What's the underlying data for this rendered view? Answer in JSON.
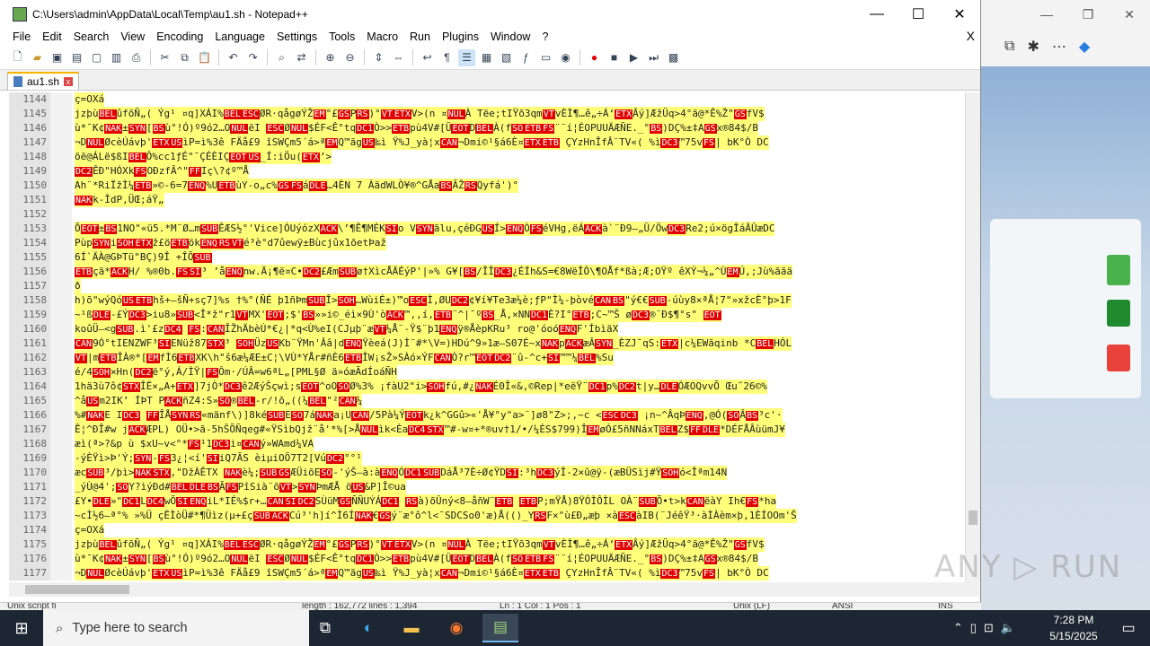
{
  "window": {
    "title": "C:\\Users\\admin\\AppData\\Local\\Temp\\au1.sh - Notepad++",
    "minimize": "—",
    "maximize": "☐",
    "close": "✕"
  },
  "menu": {
    "items": [
      "File",
      "Edit",
      "Search",
      "View",
      "Encoding",
      "Language",
      "Settings",
      "Tools",
      "Macro",
      "Run",
      "Plugins",
      "Window",
      "?"
    ],
    "close": "X"
  },
  "tab": {
    "label": "au1.sh",
    "close": "x"
  },
  "editor": {
    "lines": [
      {
        "n": "1144",
        "hl": true,
        "t": "ç=OXá"
      },
      {
        "n": "1145",
        "hl": true,
        "t": "    jzþùBELûfõÑ„( Ýg¹ ¤q]XÁI%BELESCØR·qågøÝŽEM°£GSPRS)°VTETXV>(n ¤NULÀ Tëe;tIŸõ3qmVTvÈÌ¶…ê„÷Á‘ETXÂý]ÆžÜq>4°ä@*Ê%Ž\"GSfV$"
      },
      {
        "n": "1146",
        "hl": true,
        "t": "ù*¯K¢NAK±SYN[BSù°!Ó)º9ó2…ONULëI ESCØNUL$ÉF<Ê°tqDC1Ò>>ETBpù4V#[ÜEOTDBELÀ(fSOETBFS¨¨í¦ÉOPUUÄÆÑE._°BS)DÇ%±‡AGSx®84$/B"
      },
      {
        "n": "1147",
        "hl": true,
        "t": "¬DNULØcèÚávþ'ETXUSìP=ì%3ê  FÄå£9 îSWÇm5´á>ªEMQ™ãgUS‰ì Ÿ%J_yà¦xCAN¬Dmi©¹§á6È¤ETXETB   ÇYzHnÎfÂ¨TV«( %ìDC3™75vFS| bK°Ò DC"
      },
      {
        "n": "1148",
        "hl": true,
        "t": "öë@ÁLë$ßIBELÔ%cc1ƒÉ\"¯ÇÉÈIÇEOTUS_Í:iÖu(ETX’>"
      },
      {
        "n": "1149",
        "hl": true,
        "t": "DC2ÊÐ\"HÓXkFSOÐzfÂ^\"FFIç\\?¢º™Å"
      },
      {
        "n": "1150",
        "hl": true,
        "t": "Ah¨*RiÏžÌ¼ETB»©-6=7ENQ%UETBùY-o„c%GSFSáDLE…4ÈN 7 ÀädWLÒ¥®^GÅaBSÃŽRSQyfá')°"
      },
      {
        "n": "1151",
        "hl": true,
        "t": "NAKk-ÎdP,ÜŒ;áŸ„"
      },
      {
        "n": "1152",
        "hl": false,
        "t": ""
      },
      {
        "n": "1153",
        "hl": true,
        "t": "ÕEOT±BS1NO\"«ü5.*M¨Ø…mSUBÊÆS½°'Vice]ÓUýózXACK\\’¶Ê¶MÉKSIo   VSYNãlu,çéÐGUSÍ>ENQÒFSéVHg,ëÁACKà`¨Ð9–„Ü/ÖwDC3Re2;ú×ögÎáÂÛæDC"
      },
      {
        "n": "1154",
        "hl": true,
        "t": "PùpSYNiSOHETXž£öETBökENQRSVTé³è°d7ûewÿ±Bùcjûx1õetÞaž"
      },
      {
        "n": "1155",
        "hl": true,
        "t": "6Í`ÄÀ@GÞTü\"BÇ)9Î +ÎÕSUB"
      },
      {
        "n": "1156",
        "hl": true,
        "t": "ETBçã*ACKH/ %®0b.FSSI³ ’åENQnw.Ä¡¶ë¤C•DC2£ÆmSUBø†XìcÅÄÉýP'|»% G¥[BS/ÎÎDC3¿ÉÍh&S=€8WëÎÔ\\¶OÅf*ßà;Æ;OŸº êXÝ¬¼„^ÙEMÚ,;Jù%ããä"
      },
      {
        "n": "1157",
        "hl": true,
        "t": "ð"
      },
      {
        "n": "1158",
        "hl": true,
        "t": "h)õ\"wýQóUSETBhš+—šÑ+sç7]%s †%°(ÑÉ þ1ñÞmSUBÎ>SOH…WùiÉ±)™oESCÌ,ØUDC2¢¥í¥Te3æ¼è;ƒP\"Ì¼-þòvéCANBS\"ý€€SUB-úùy8×ªÅ¦7\"»xžcÈ°þ>1F"
      },
      {
        "n": "1159",
        "hl": true,
        "t": "~¹ßDLE-£ÝDC3>iu8»SUB<Î*ž\"r1VTMX'EOT;$'BS»»i©_éì×9Ù'òACK™,,í,ETB¨^|¯ºBS_Å,×NNDC1È?I°ETB;C~™Š    øDC3®¨Ð$¶°s\"   EOT"
      },
      {
        "n": "1160",
        "hl": true,
        "t": "koûÜ–<gSUB.ì'£zDC4 FS:CANÎŽhÄbèÚ*€¿|*q<Ù%eI(CJµþ¨æVT¼Å¨-Ÿ$¨þ1ENQÿ®ÅèpKRu³ ro@'óoóENQF'ÍbìäX"
      },
      {
        "n": "1161",
        "hl": true,
        "t": "CAN9Ó°tIENZWF³SIENüž87STX³ SOHÜzUSKb¨ŸMn'Ââ|dENQŸèeá(J)Ì¨#*\\V=)HDú^9»1æ—S07É~xNAKpACKæÂSYN_ÈZJ¯qS:ETX|c¼EWãqinb *CBELHÓL"
      },
      {
        "n": "1162",
        "hl": true,
        "t": "VT|mETBÎÀ®*[EMfÌ6ETBXK\\h\"š6æ¼ÆE±C¦\\VÙ*YÅr#ñÈ6ETBÎW¡sŽ»SÀó×ÝFCANÒ?r™EOTDC2¨û-^c+SI™™¼BEL%Su"
      },
      {
        "n": "1163",
        "hl": true,
        "t": "é/4SOH×Hn(DC2ë°ý,Á/ÌŸ|FSÔm·/ÚÂ=w6ªL„[PML§Ø     ä»óæÃdÍoáÑH"
      },
      {
        "n": "1164",
        "hl": true,
        "t": "1hä3ù7ô¢STXÎË×„A+ETX]7jÒ*DC3ê2ÆýŠçwì;sEOT^oOSOØ%3%     ¡fàU2\"i>SOHfú,#¿NAKÉ0Î«&,©Rep|*eëŸ¨DC1p%DC2t|y…DLEÓÆOQvvÕ Œu˜26©%"
      },
      {
        "n": "1165",
        "hl": true,
        "t": "^åUSm2IK’ ÍÞT   PACKñZ4:S»SO®BEL-r/!õ„((¼BEL\"²CAN¼"
      },
      {
        "n": "1166",
        "hl": true,
        "t": "%#NAKE IDC3 FFÎÅSYNRS«mänf\\)]8kéSUBESO7áNAKa¡UCAN/5Pà¼ÝEOTk¿k^GGû>«'Å¥°y\"a>¨]ø8\"Z>;,~c <ESCDC3  ¡n~^ÂqÞENQ,@Ó(SOÂBS³c'·"
      },
      {
        "n": "1167",
        "hl": true,
        "t": "Ê¦^ÐÎ#w jACKÆPL) OÜ•>ã-5hŠÕÑqeg#«ŸSìbQjž¨å'*%[>ÅNULìk<ÈaDC4STX™#-w¤+*®uv†1/•/¼ÉS$799)ÎEMøÓ£5ñNNáxTBELZ$FFDLE*DÉFÅÂùümJ¥"
      },
      {
        "n": "1168",
        "hl": true,
        "t": "æì(ª>?&p ù $xU~v<°*FS¹1DC3i¤CANý»WAmd¼VA"
      },
      {
        "n": "1169",
        "hl": true,
        "t": "-ýÈŸì>Þ'Ý;SYN-FS3¿¦<í'SIiQ7ÃS  èiµiOÕ7T2[VúDC2°°¹"
      },
      {
        "n": "1170",
        "hl": true,
        "t": "æcSUB³/þì>NAKSTX,\"DžÀÊTX NAKè¼;SUBGSÆÜiõESO-'ýŠ–à:àENQÓDC1SUBDáÅ³7È÷Ø¢ŸDSI:³hDC3ýÎ-2×û@ÿ-(æBÜSìj#ŸSOHó<Îªm14N"
      },
      {
        "n": "1171",
        "hl": true,
        "t": "_ýÙ@4';SOY?ìýÐd#BELDLEBSÃFSPîSià¨õVT>SYNÞmÆÅ  öUS&P]Î©ua"
      },
      {
        "n": "1172",
        "hl": true,
        "t": "£Y•DLE»\"DC1LDC4wÕSIENQiL*IÉ%$r+…CANSIDC2SÙüMGSÑÑUÝÁDC1  RSà)õÛný<8—åñW¨ETB ETBP;mŸÅ)8ŸÓÌÔÌL OÀ¨SUBÕ•t>kCANëàY Ih€FS*ha"
      },
      {
        "n": "1173",
        "hl": true,
        "t": "~cÌ½6—ª°% »%Ü çËÌòÜ#*¶Üìz(µ+£çSUBACKCú³'h]í^Ì6ÍNAK€GSý¨æ°ô^l<¯SDCSo0'æ)Å(()_YRSF×\"ù£Ð„æþ ×àESCàIB(¨JéêŸ³·àÌÀèm×þ,1ÈÍOOm'Š"
      },
      {
        "n": "1174",
        "hl": true,
        "t": "ç=OXá"
      },
      {
        "n": "1175",
        "hl": true,
        "t": "    jzþùBELûfõÑ„( Ýg¹ ¤q]XÁI%BELESCØR·qågøÝŽEM°£GSPRS)°VTETXV>(n ¤NULÀ Tëe;tIŸõ3qmVTvÈÌ¶…ê„÷Á‘ETXÂý]ÆžÜq>4°ä@*Ê%Ž\"GSfV$"
      },
      {
        "n": "1176",
        "hl": true,
        "t": "ù*¯K¢NAK±SYN[BSù°!Ó)º9ó2…ONULëI ESCØNUL$ÉF<Ê°tqDC1Ò>>ETBpù4V#[ÜEOTDBELÀ(fSOETBFS¨¨í¦ÉOPUUÄÆÑE._°BS)DÇ%±‡AGSx®84$/B"
      },
      {
        "n": "1177",
        "hl": true,
        "t": "¬DNULØcèÚávþ'ETXUSìP=ì%3ê  FÄå£9 îSWÇm5´á>ªEMQ™ãgUS‰ì Ÿ%J_yà¦xCAN¬Dmi©¹§á6È¤ETXETB   ÇYzHnÎfÂ¨TV«( %ìDC3™75vFS| bK°Ò DC"
      }
    ]
  },
  "status": {
    "filetype": "Unix script fi",
    "length": "length : 162,772    lines : 1,394",
    "position": "Ln : 1    Col : 1    Pos : 1",
    "eol": "Unix (LF)",
    "encoding": "ANSI",
    "mode": "INS"
  },
  "watermark": "ANY ▷ RUN",
  "taskbar": {
    "search_placeholder": "Type here to search",
    "time": "7:28 PM",
    "date": "5/15/2025"
  },
  "colors": {
    "highlight": "#ffff7a",
    "control_char": "#e10000",
    "taskbar": "#1d2733"
  }
}
